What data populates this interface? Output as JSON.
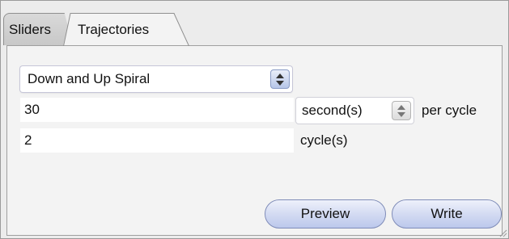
{
  "tabs": [
    {
      "label": "Sliders",
      "active": false
    },
    {
      "label": "Trajectories",
      "active": true
    }
  ],
  "trajectory": {
    "shape_value": "Down and Up Spiral",
    "duration_value": "30",
    "duration_unit": "second(s)",
    "per_cycle_label": "per cycle",
    "cycles_value": "2",
    "cycles_unit_label": "cycle(s)"
  },
  "actions": {
    "preview_label": "Preview",
    "write_label": "Write"
  },
  "icons": {
    "stepper": "up-down-arrows-icon",
    "resize": "resize-grip-icon"
  },
  "colors": {
    "panel_bg": "#f3f3f3",
    "window_bg": "#ececec",
    "button_accent": "#bcc8ec",
    "stepper_accent": "#8a9cc6"
  }
}
